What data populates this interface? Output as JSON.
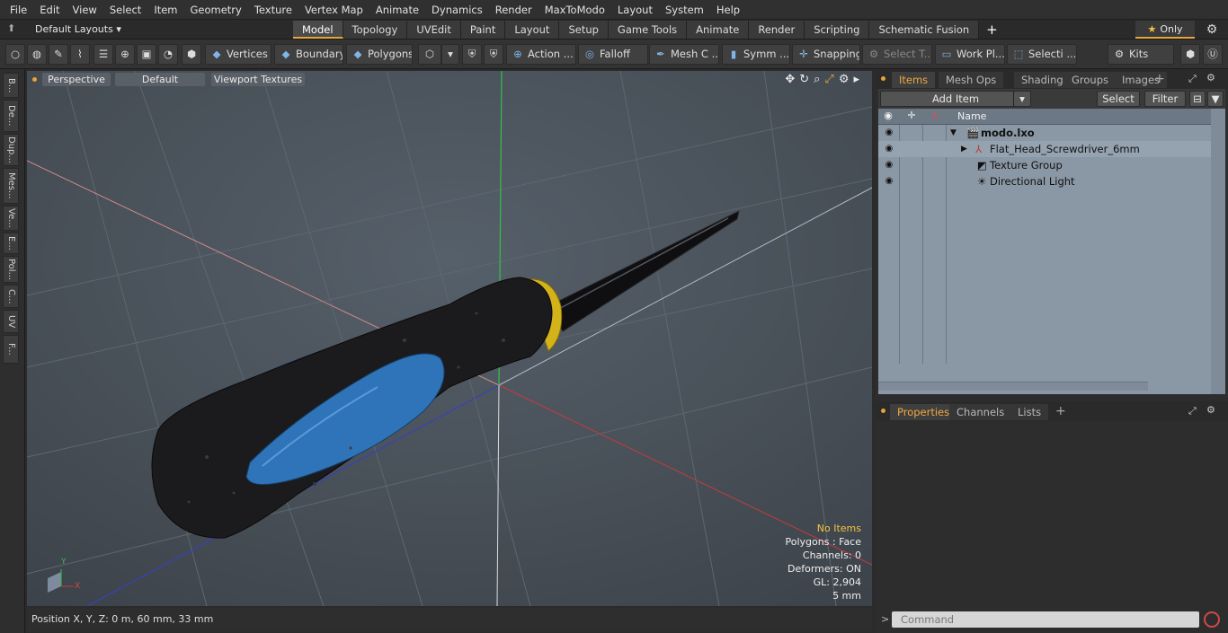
{
  "menu": [
    "File",
    "Edit",
    "View",
    "Select",
    "Item",
    "Geometry",
    "Texture",
    "Vertex Map",
    "Animate",
    "Dynamics",
    "Render",
    "MaxToModo",
    "Layout",
    "System",
    "Help"
  ],
  "layout": {
    "preset": "Default Layouts",
    "tabs": [
      "Model",
      "Topology",
      "UVEdit",
      "Paint",
      "Layout",
      "Setup",
      "Game Tools",
      "Animate",
      "Render",
      "Scripting",
      "Schematic Fusion"
    ],
    "active_tab": "Model",
    "only_label": "Only"
  },
  "toolbar": {
    "vertices": "Vertices",
    "boundary": "Boundary",
    "polygons": "Polygons",
    "action": "Action ...",
    "falloff": "Falloff",
    "mesh": "Mesh C ...",
    "symm": "Symm ...",
    "snapping": "Snapping",
    "select_t": "Select T...",
    "work_pl": "Work Pl...",
    "selecti": "Selecti ...",
    "kits": "Kits"
  },
  "left_tabs": [
    "B...",
    "De...",
    "Dup...",
    "Mes...",
    "Ve...",
    "E...",
    "Pol...",
    "C...",
    "UV",
    "F..."
  ],
  "viewport": {
    "view": "Perspective",
    "style": "Default",
    "shading": "Viewport Textures",
    "info": {
      "selection": "No Items",
      "polygons": "Polygons : Face",
      "channels": "Channels: 0",
      "deformers": "Deformers: ON",
      "gl": "GL: 2,904",
      "unit": "5 mm"
    },
    "axis_y": "Y",
    "axis_x": "X"
  },
  "status": {
    "position": "Position X, Y, Z:   0 m, 60 mm, 33 mm"
  },
  "right_panel": {
    "tabs": [
      "Items",
      "Mesh Ops",
      "Shading",
      "Groups",
      "Images"
    ],
    "active_tab": "Items",
    "add_item": "Add Item",
    "select": "Select",
    "filter": "Filter",
    "name_header": "Name",
    "tree": [
      {
        "name": "modo.lxo",
        "level": 0,
        "bold": true
      },
      {
        "name": "Flat_Head_Screwdriver_6mm",
        "level": 1
      },
      {
        "name": "Texture Group",
        "level": 1
      },
      {
        "name": "Directional Light",
        "level": 1
      }
    ],
    "bottom_tabs": [
      "Properties",
      "Channels",
      "Lists"
    ],
    "bottom_active": "Properties",
    "command_placeholder": "Command"
  },
  "colors": {
    "accent": "#e8a43a",
    "viewport_bg": "#4a5159",
    "handle_black": "#1b1b1d",
    "handle_blue": "#2f74b8",
    "ferrule_yellow": "#d4b21a"
  }
}
